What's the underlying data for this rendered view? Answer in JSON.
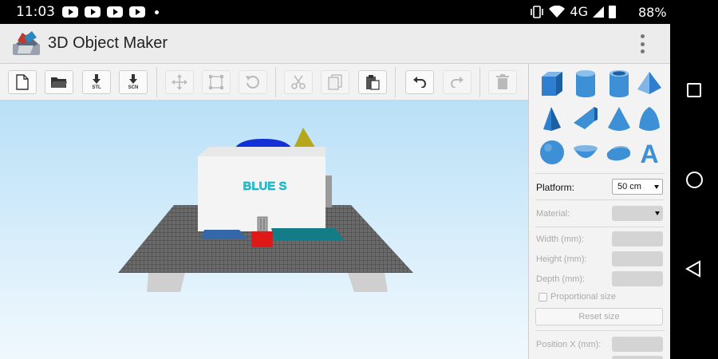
{
  "status_bar": {
    "time": "11:03",
    "network": "4G",
    "battery": "88%",
    "notification_icons": [
      "youtube-icon",
      "youtube-icon",
      "youtube-icon",
      "youtube-icon"
    ]
  },
  "app_bar": {
    "title": "3D Object Maker"
  },
  "toolbar": {
    "buttons": [
      {
        "name": "new-file",
        "enabled": true
      },
      {
        "name": "open-folder",
        "enabled": true
      },
      {
        "name": "export-stl",
        "label": "STL",
        "enabled": true
      },
      {
        "name": "export-scn",
        "label": "SCN",
        "enabled": true
      },
      {
        "name": "move",
        "enabled": false
      },
      {
        "name": "scale",
        "enabled": false
      },
      {
        "name": "rotate",
        "enabled": false
      },
      {
        "name": "cut",
        "enabled": false
      },
      {
        "name": "copy",
        "enabled": false
      },
      {
        "name": "paste",
        "enabled": true
      },
      {
        "name": "undo",
        "enabled": true
      },
      {
        "name": "redo",
        "enabled": false
      },
      {
        "name": "delete",
        "enabled": false
      }
    ]
  },
  "viewport": {
    "object_text": "BLUE S"
  },
  "panel": {
    "shapes": [
      "cube",
      "cylinder",
      "tube",
      "pyramid",
      "cone-pyramid",
      "wedge",
      "cone",
      "paraboloid",
      "sphere",
      "hemisphere",
      "ellipsoid",
      "text-a"
    ],
    "text_shape_glyph": "A",
    "platform_label": "Platform:",
    "platform_value": "50 cm",
    "material_label": "Material:",
    "width_label": "Width (mm):",
    "height_label": "Height (mm):",
    "depth_label": "Depth (mm):",
    "proportional_label": "Proportional size",
    "reset_label": "Reset size",
    "position_x_label": "Position X (mm):"
  },
  "colors": {
    "accent_blue": "#3d8fd6",
    "text_object": "#1cc9d8",
    "grid": "#5c5c5c",
    "panel_bg": "#f3f3f3"
  }
}
